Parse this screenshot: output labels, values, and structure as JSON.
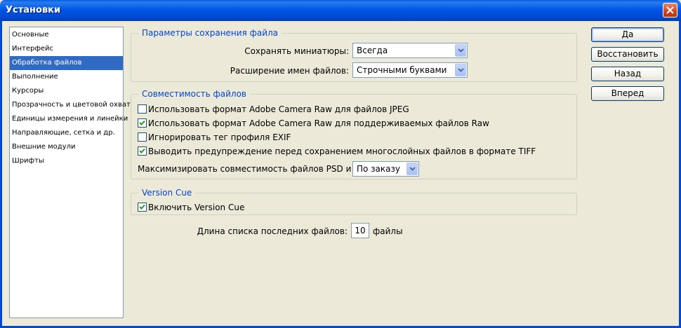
{
  "window": {
    "title": "Установки"
  },
  "sidebar": {
    "items": [
      {
        "label": "Основные",
        "selected": false
      },
      {
        "label": "Интерфейс",
        "selected": false
      },
      {
        "label": "Обработка файлов",
        "selected": true
      },
      {
        "label": "Выполнение",
        "selected": false
      },
      {
        "label": "Курсоры",
        "selected": false
      },
      {
        "label": "Прозрачность и цветовой охват",
        "selected": false
      },
      {
        "label": "Единицы измерения и линейки",
        "selected": false
      },
      {
        "label": "Направляющие, сетка и др.",
        "selected": false
      },
      {
        "label": "Внешние модули",
        "selected": false
      },
      {
        "label": "Шрифты",
        "selected": false
      }
    ]
  },
  "save_options": {
    "legend": "Параметры сохранения файла",
    "thumbnails_label": "Сохранять миниатюры:",
    "thumbnails_value": "Всегда",
    "extension_label": "Расширение имен файлов:",
    "extension_value": "Строчными буквами"
  },
  "compat": {
    "legend": "Совместимость файлов",
    "checkboxes": [
      {
        "label": "Использовать формат Adobe Camera Raw для файлов JPEG",
        "checked": false
      },
      {
        "label": "Использовать формат Adobe Camera Raw для поддерживаемых файлов Raw",
        "checked": true
      },
      {
        "label": "Игнорировать тег профиля EXIF",
        "checked": false
      },
      {
        "label": "Выводить предупреждение перед сохранением многослойных файлов в формате TIFF",
        "checked": true
      }
    ],
    "maximize_label": "Максимизировать совместимость файлов PSD и PSB:",
    "maximize_value": "По заказу"
  },
  "version_cue": {
    "legend": "Version Cue",
    "enable_label": "Включить Version Cue",
    "enable_checked": true
  },
  "recent": {
    "label": "Длина списка последних файлов:",
    "value": "10",
    "suffix": "файлы"
  },
  "buttons": {
    "ok": "Да",
    "reset": "Восстановить",
    "prev": "Назад",
    "next": "Вперед"
  },
  "icons": {
    "close": "close-icon",
    "dropdown": "chevron-down-icon",
    "check": "checkmark-icon"
  },
  "colors": {
    "titlebar": "#0055e5",
    "selection": "#316ac5",
    "legend_text": "#0046d5",
    "dialog_bg": "#ece9d8"
  }
}
